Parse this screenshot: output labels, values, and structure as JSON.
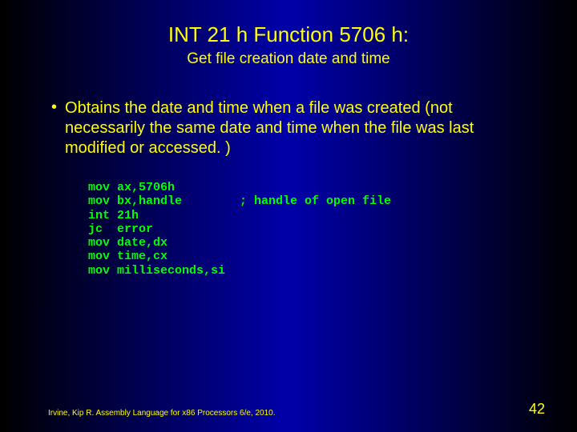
{
  "title": "INT 21 h Function 5706 h:",
  "subtitle": "Get file creation date and time",
  "bullet": "Obtains the date and time when a file was created (not necessarily the same date and time when the file was last modified or accessed. )",
  "code": "mov ax,5706h\nmov bx,handle        ; handle of open file\nint 21h\njc  error\nmov date,dx\nmov time,cx\nmov milliseconds,si",
  "footer_left": "Irvine, Kip R. Assembly Language for x86 Processors 6/e, 2010.",
  "footer_right": "42"
}
